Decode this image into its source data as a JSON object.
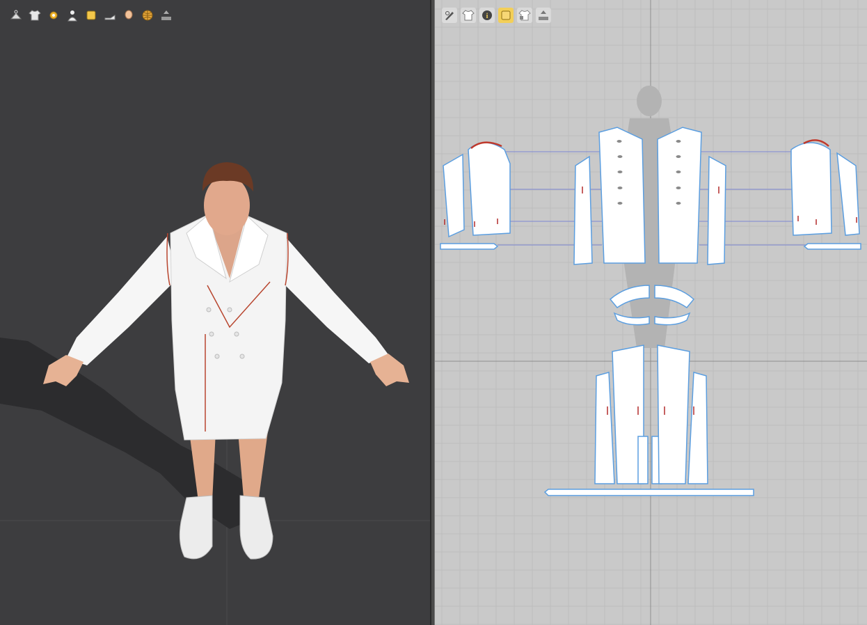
{
  "viewport_3d": {
    "toolbar": [
      {
        "icon": "hanger-icon"
      },
      {
        "icon": "shirt-icon"
      },
      {
        "icon": "sun-icon"
      },
      {
        "icon": "avatar-icon"
      },
      {
        "icon": "fabric-swatch-icon"
      },
      {
        "icon": "shoe-icon"
      },
      {
        "icon": "face-icon"
      },
      {
        "icon": "globe-icon"
      },
      {
        "icon": "export-icon"
      }
    ]
  },
  "viewport_2d": {
    "toolbar": [
      {
        "icon": "pen-eye-icon"
      },
      {
        "icon": "shirt-icon"
      },
      {
        "icon": "info-icon"
      },
      {
        "icon": "fabric-swatch-icon",
        "active": true
      },
      {
        "icon": "lock-shirt-icon"
      },
      {
        "icon": "export-icon"
      }
    ]
  },
  "colors": {
    "viewport_3d_bg": "#3d3d3f",
    "viewport_2d_bg": "#c9c9c9",
    "grid_line": "#b9b9b9",
    "pattern_fill": "#ffffff",
    "pattern_outline": "#6aa8e6",
    "seam_highlight": "#c0392b",
    "active_tool": "#f3cf58"
  }
}
